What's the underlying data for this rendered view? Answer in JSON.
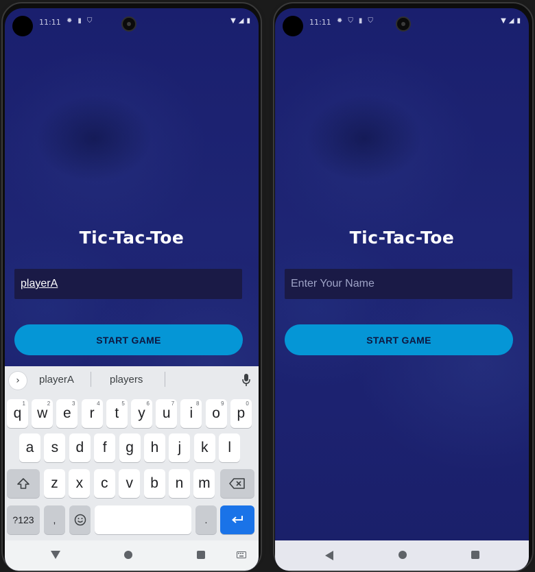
{
  "status": {
    "time": "11:11",
    "left_icons_a": [
      "gear-icon",
      "sim-icon",
      "shield-icon"
    ],
    "left_icons_b": [
      "gear-icon",
      "shield-icon",
      "sim-icon",
      "shield-icon"
    ]
  },
  "app": {
    "title": "Tic-Tac-Toe",
    "start_button": "START GAME"
  },
  "left_screen": {
    "name_value": "playerA"
  },
  "right_screen": {
    "name_placeholder": "Enter Your Name"
  },
  "keyboard": {
    "suggestions": [
      "playerA",
      "players"
    ],
    "row1": [
      {
        "k": "q",
        "h": "1"
      },
      {
        "k": "w",
        "h": "2"
      },
      {
        "k": "e",
        "h": "3"
      },
      {
        "k": "r",
        "h": "4"
      },
      {
        "k": "t",
        "h": "5"
      },
      {
        "k": "y",
        "h": "6"
      },
      {
        "k": "u",
        "h": "7"
      },
      {
        "k": "i",
        "h": "8"
      },
      {
        "k": "o",
        "h": "9"
      },
      {
        "k": "p",
        "h": "0"
      }
    ],
    "row2": [
      "a",
      "s",
      "d",
      "f",
      "g",
      "h",
      "j",
      "k",
      "l"
    ],
    "row3": [
      "z",
      "x",
      "c",
      "v",
      "b",
      "n",
      "m"
    ],
    "symbols_label": "?123",
    "comma": ",",
    "period": "."
  }
}
